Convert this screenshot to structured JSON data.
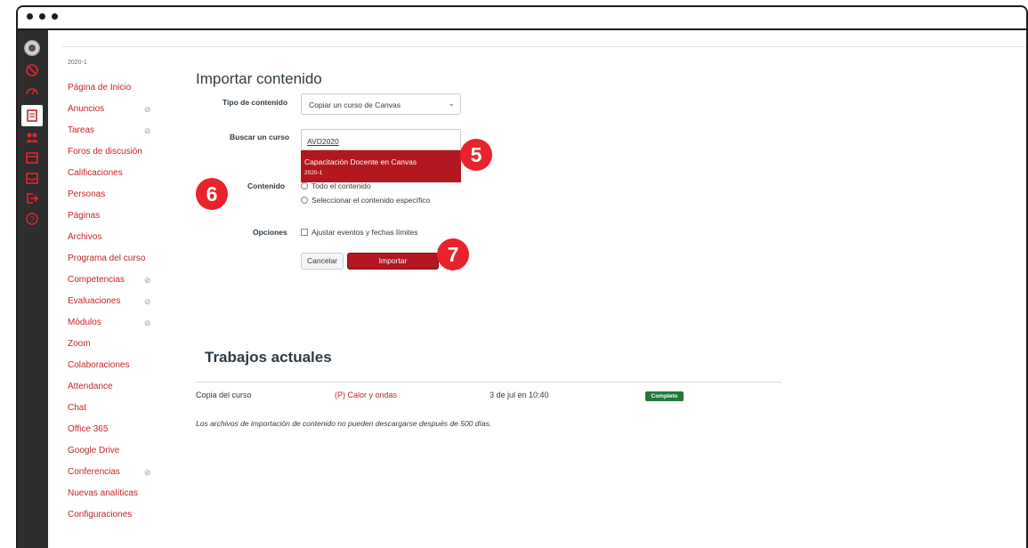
{
  "course_nav": {
    "term": "2020-1",
    "items": [
      {
        "label": "Página de Inicio",
        "hidden": false
      },
      {
        "label": "Anuncios",
        "hidden": true
      },
      {
        "label": "Tareas",
        "hidden": true
      },
      {
        "label": "Foros de discusión",
        "hidden": false
      },
      {
        "label": "Calificaciones",
        "hidden": false
      },
      {
        "label": "Personas",
        "hidden": false
      },
      {
        "label": "Páginas",
        "hidden": false
      },
      {
        "label": "Archivos",
        "hidden": false
      },
      {
        "label": "Programa del curso",
        "hidden": false
      },
      {
        "label": "Competencias",
        "hidden": true
      },
      {
        "label": "Evaluaciones",
        "hidden": true
      },
      {
        "label": "Módulos",
        "hidden": true
      },
      {
        "label": "Zoom",
        "hidden": false
      },
      {
        "label": "Colaboraciones",
        "hidden": false
      },
      {
        "label": "Attendance",
        "hidden": false
      },
      {
        "label": "Chat",
        "hidden": false
      },
      {
        "label": "Office 365",
        "hidden": false
      },
      {
        "label": "Google Drive",
        "hidden": false
      },
      {
        "label": "Conferencias",
        "hidden": true
      },
      {
        "label": "Nuevas analíticas",
        "hidden": false
      },
      {
        "label": "Configuraciones",
        "hidden": false
      }
    ],
    "hidden_icon": "eye-off-icon"
  },
  "import": {
    "title": "Importar contenido",
    "type_label": "Tipo de contenido",
    "type_value": "Copiar un curso de Canvas",
    "search_label": "Buscar un curso",
    "search_value": "AVD2020",
    "suggestion_title": "Capacitación Docente en Canvas",
    "suggestion_term": "2020-1",
    "content_label": "Contenido",
    "content_options": [
      "Todo el contenido",
      "Seleccionar el contenido específico"
    ],
    "options_label": "Opciones",
    "options_checkbox": "Ajustar eventos y fechas límites",
    "cancel": "Cancelar",
    "submit": "Importar"
  },
  "markers": [
    "5",
    "6",
    "7"
  ],
  "jobs": {
    "title": "Trabajos actuales",
    "rows": [
      {
        "type": "Copia del curso",
        "course": "(P) Calor y ondas",
        "date": "3 de jul en 10:40",
        "status": "Completo"
      }
    ],
    "note": "Los archivos de importación de contenido no pueden descargarse después de 500 días."
  },
  "colors": {
    "brand": "#b3171f",
    "marker": "#e8232b",
    "success": "#1e7a3a",
    "nav_bg": "#2d2d2d"
  }
}
